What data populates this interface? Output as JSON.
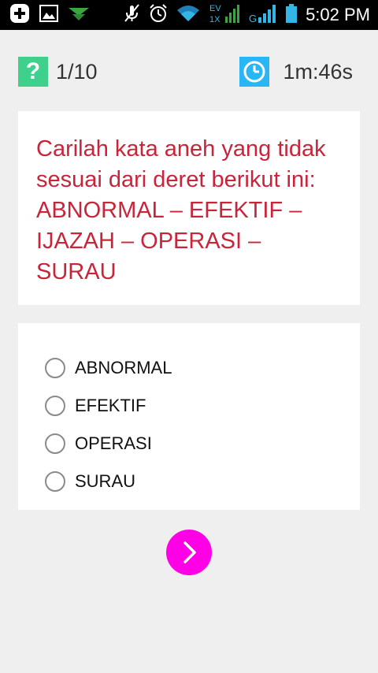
{
  "status_bar": {
    "time": "5:02 PM",
    "icons": [
      "add-notification-icon",
      "image-notification-icon",
      "download-notification-icon",
      "mute-icon",
      "alarm-icon",
      "wifi-icon",
      "data-ev-1x-icon",
      "signal-icon",
      "battery-icon"
    ],
    "data_label_top": "EV",
    "data_label_bottom": "1X",
    "network_label": "G"
  },
  "header": {
    "question_icon_glyph": "?",
    "question_counter": "1/10",
    "timer": "1m:46s",
    "accent_question": "#3fd08b",
    "accent_timer": "#29b6f6"
  },
  "question": {
    "text": "Carilah kata aneh yang tidak sesuai dari deret berikut ini: ABNORMAL – EFEKTIF – IJAZAH – OPERASI – SURAU",
    "color": "#c8243a"
  },
  "options": [
    {
      "label": "ABNORMAL"
    },
    {
      "label": "EFEKTIF"
    },
    {
      "label": "OPERASI"
    },
    {
      "label": "SURAU"
    }
  ],
  "next_button": {
    "icon": "chevron-right-icon",
    "color": "#ff00e6"
  }
}
